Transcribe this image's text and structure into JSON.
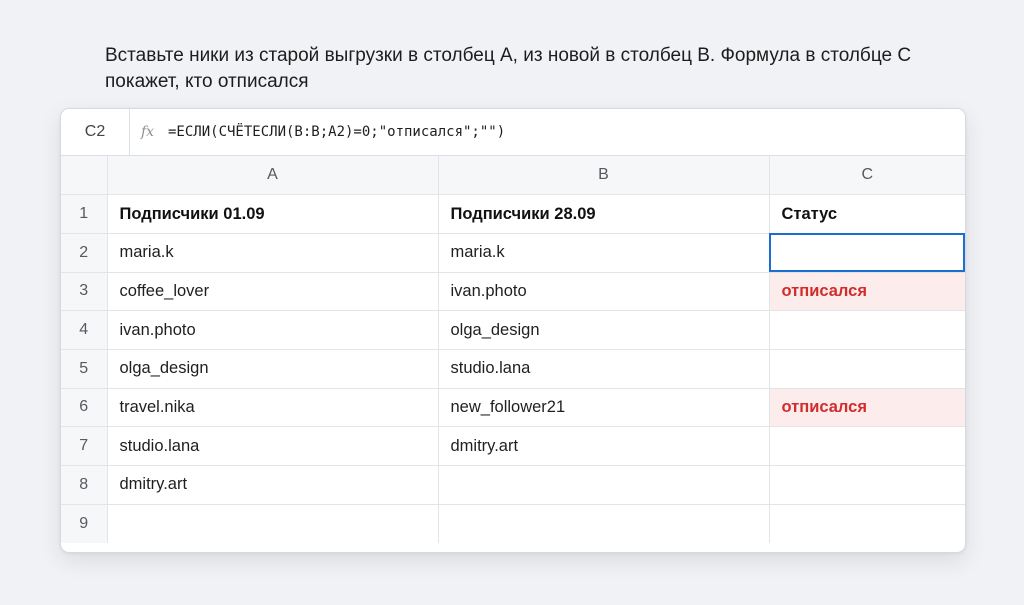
{
  "instruction": "Вставьте ники из старой выгрузки в столбец A, из новой в столбец B. Формула в столбце C покажет, кто отписался",
  "formula_bar": {
    "cell_ref": "C2",
    "fx_icon": "fx",
    "formula": "=ЕСЛИ(СЧЁТЕСЛИ(B:B;A2)=0;\"отписался\";\"\")"
  },
  "columns": [
    "A",
    "B",
    "C"
  ],
  "rows": [
    {
      "num": "1",
      "a": "Подписчики 01.09",
      "b": "Подписчики 28.09",
      "c": "Статус"
    },
    {
      "num": "2",
      "a": "maria.k",
      "b": "maria.k",
      "c": ""
    },
    {
      "num": "3",
      "a": "coffee_lover",
      "b": "ivan.photo",
      "c": "отписался"
    },
    {
      "num": "4",
      "a": "ivan.photo",
      "b": "olga_design",
      "c": ""
    },
    {
      "num": "5",
      "a": "olga_design",
      "b": "studio.lana",
      "c": ""
    },
    {
      "num": "6",
      "a": "travel.nika",
      "b": "new_follower21",
      "c": "отписался"
    },
    {
      "num": "7",
      "a": "studio.lana",
      "b": "dmitry.art",
      "c": ""
    },
    {
      "num": "8",
      "a": "dmitry.art",
      "b": "",
      "c": ""
    },
    {
      "num": "9",
      "a": "",
      "b": "",
      "c": ""
    }
  ],
  "colors": {
    "selection": "#1b6fd1",
    "unsubscribed_text": "#d22c2c",
    "unsubscribed_fill": "#fdecec"
  }
}
